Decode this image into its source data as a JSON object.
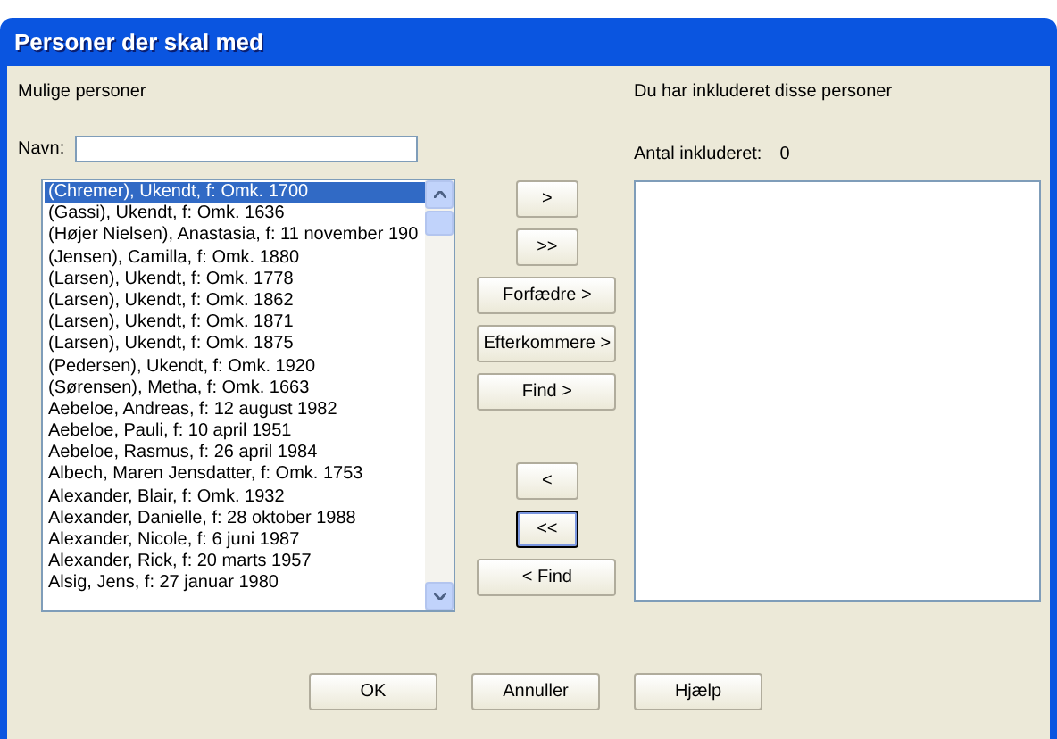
{
  "window": {
    "title": "Personer der skal med"
  },
  "left": {
    "heading": "Mulige personer",
    "name_label": "Navn:",
    "persons": [
      {
        "text": "(Chremer), Ukendt, f: Omk. 1700",
        "selected": true
      },
      {
        "text": "(Gassi), Ukendt, f: Omk. 1636",
        "selected": false
      },
      {
        "text": "(Højer Nielsen), Anastasia, f: 11 november 190",
        "selected": false
      },
      {
        "text": "(Jensen), Camilla, f: Omk. 1880",
        "selected": false
      },
      {
        "text": "(Larsen), Ukendt, f: Omk. 1778",
        "selected": false
      },
      {
        "text": "(Larsen), Ukendt, f: Omk. 1862",
        "selected": false
      },
      {
        "text": "(Larsen), Ukendt, f: Omk. 1871",
        "selected": false
      },
      {
        "text": "(Larsen), Ukendt, f: Omk. 1875",
        "selected": false
      },
      {
        "text": "(Pedersen), Ukendt, f: Omk. 1920",
        "selected": false
      },
      {
        "text": "(Sørensen), Metha, f: Omk. 1663",
        "selected": false
      },
      {
        "text": "Aebeloe, Andreas, f: 12 august 1982",
        "selected": false
      },
      {
        "text": "Aebeloe, Pauli, f: 10 april 1951",
        "selected": false
      },
      {
        "text": "Aebeloe, Rasmus, f: 26 april 1984",
        "selected": false
      },
      {
        "text": "Albech, Maren Jensdatter, f: Omk. 1753",
        "selected": false
      },
      {
        "text": "Alexander, Blair, f: Omk. 1932",
        "selected": false
      },
      {
        "text": "Alexander, Danielle, f: 28 oktober 1988",
        "selected": false
      },
      {
        "text": "Alexander, Nicole, f: 6 juni 1987",
        "selected": false
      },
      {
        "text": "Alexander, Rick, f: 20 marts 1957",
        "selected": false
      },
      {
        "text": "Alsig, Jens, f: 27 januar 1980",
        "selected": false
      }
    ]
  },
  "middle": {
    "add_buttons": [
      {
        "label": ">",
        "kind": "arrow",
        "default": false
      },
      {
        "label": ">>",
        "kind": "arrow",
        "default": false
      },
      {
        "label": "Forfædre >",
        "kind": "text",
        "default": false
      },
      {
        "label": "Efterkommere >",
        "kind": "text",
        "default": false
      },
      {
        "label": "Find >",
        "kind": "text",
        "default": false
      }
    ],
    "remove_buttons": [
      {
        "label": "<",
        "kind": "arrow",
        "default": false
      },
      {
        "label": "<<",
        "kind": "arrow",
        "default": true
      },
      {
        "label": "< Find",
        "kind": "text",
        "default": false
      }
    ]
  },
  "right": {
    "heading": "Du har inkluderet disse personer",
    "count_label": "Antal inkluderet:",
    "count": "0"
  },
  "buttons": [
    "OK",
    "Annuller",
    "Hjælp"
  ]
}
